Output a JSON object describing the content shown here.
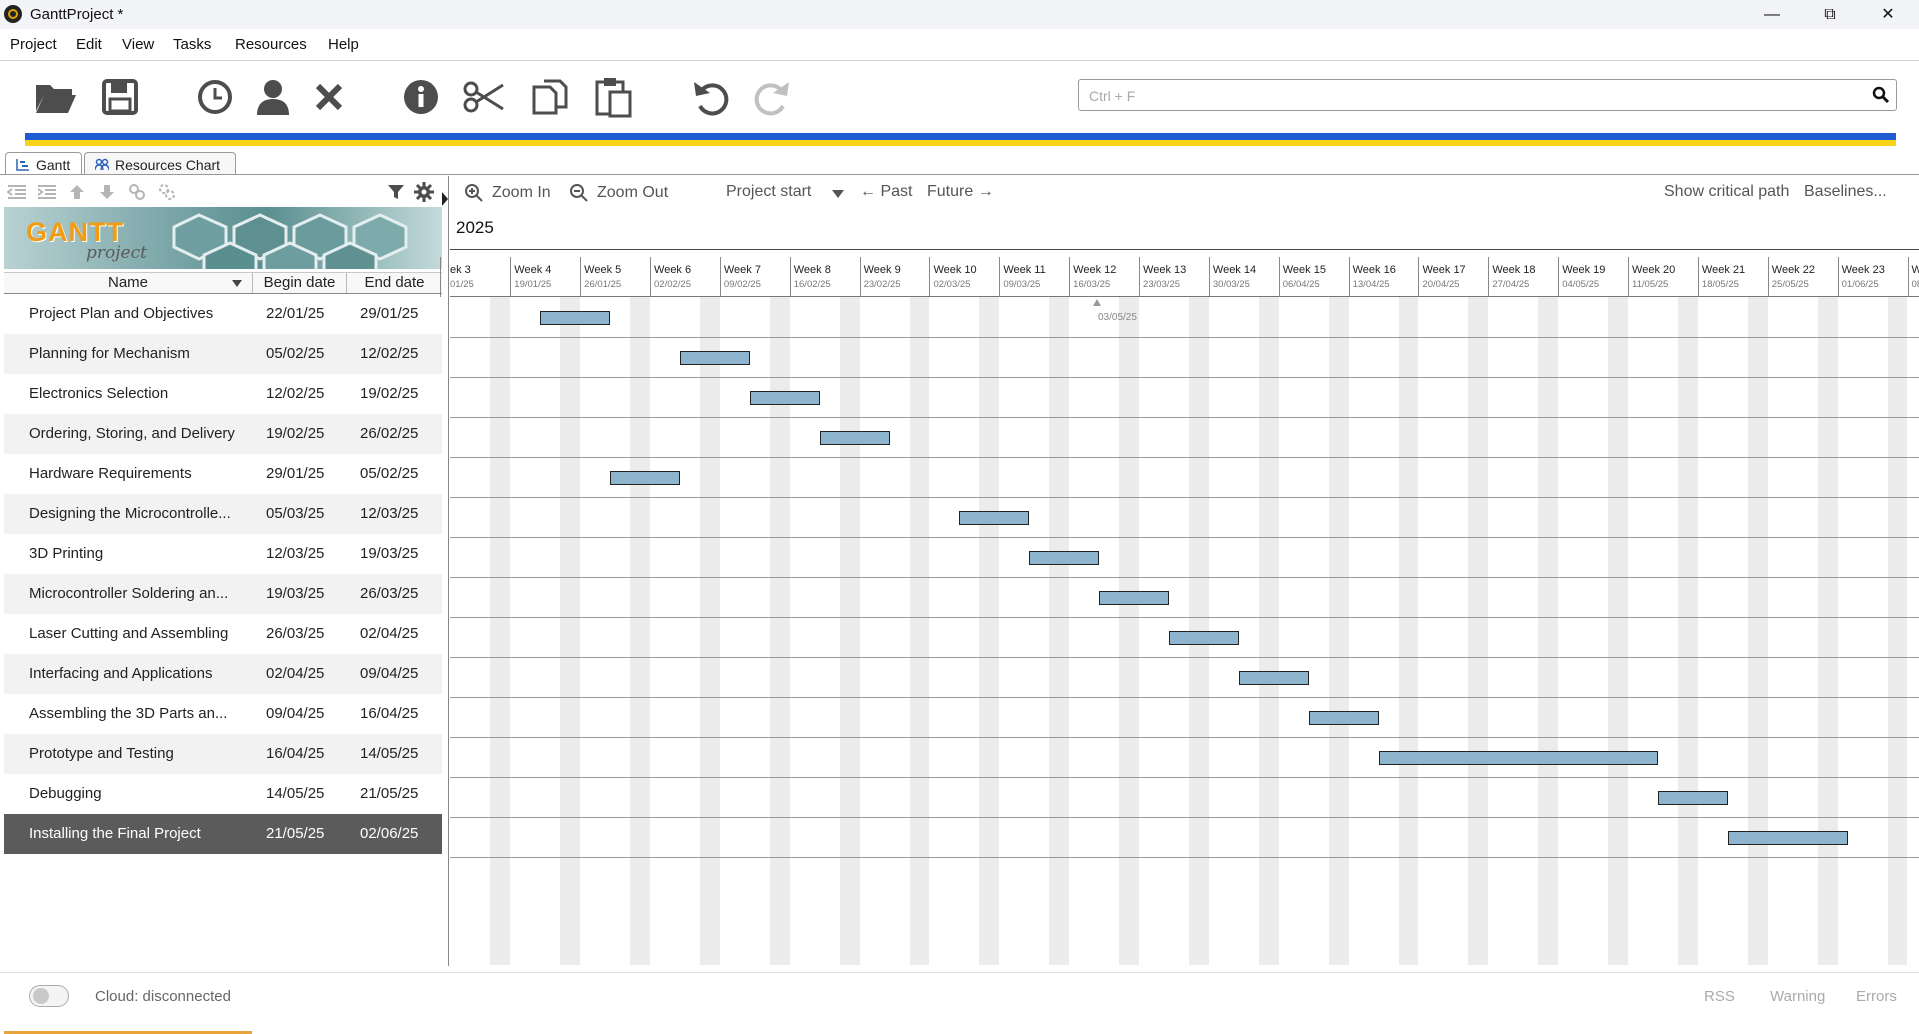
{
  "window": {
    "title": "GanttProject *",
    "minimize": "—",
    "maximize": "⧉",
    "close": "✕"
  },
  "menu": [
    "Project",
    "Edit",
    "View",
    "Tasks",
    "Resources",
    "Help"
  ],
  "toolbar": {
    "icons": [
      "open-folder-icon",
      "save-icon",
      "clock-icon",
      "user-icon",
      "delete-icon",
      "info-icon",
      "cut-icon",
      "copy-icon",
      "paste-icon",
      "undo-icon",
      "redo-icon"
    ],
    "search_placeholder": "Ctrl + F"
  },
  "tabs": [
    {
      "label": "Gantt",
      "active": true
    },
    {
      "label": "Resources Chart",
      "active": false
    }
  ],
  "logo": {
    "main": "GANTT",
    "sub": "project"
  },
  "columns": {
    "name": "Name",
    "begin": "Begin date",
    "end": "End date"
  },
  "tasks": [
    {
      "name": "Project Plan and Objectives",
      "begin": "22/01/25",
      "end": "29/01/25"
    },
    {
      "name": "Planning for Mechanism",
      "begin": "05/02/25",
      "end": "12/02/25"
    },
    {
      "name": "Electronics Selection",
      "begin": "12/02/25",
      "end": "19/02/25"
    },
    {
      "name": "Ordering, Storing, and Delivery",
      "begin": "19/02/25",
      "end": "26/02/25"
    },
    {
      "name": "Hardware Requirements",
      "begin": "29/01/25",
      "end": "05/02/25"
    },
    {
      "name": "Designing the Microcontrolle...",
      "begin": "05/03/25",
      "end": "12/03/25"
    },
    {
      "name": "3D Printing",
      "begin": "12/03/25",
      "end": "19/03/25"
    },
    {
      "name": "Microcontroller Soldering an...",
      "begin": "19/03/25",
      "end": "26/03/25"
    },
    {
      "name": "Laser Cutting and Assembling",
      "begin": "26/03/25",
      "end": "02/04/25"
    },
    {
      "name": "Interfacing and Applications",
      "begin": "02/04/25",
      "end": "09/04/25"
    },
    {
      "name": "Assembling the 3D Parts an...",
      "begin": "09/04/25",
      "end": "16/04/25"
    },
    {
      "name": "Prototype and Testing",
      "begin": "16/04/25",
      "end": "14/05/25"
    },
    {
      "name": "Debugging",
      "begin": "14/05/25",
      "end": "21/05/25"
    },
    {
      "name": "Installing the Final Project",
      "begin": "21/05/25",
      "end": "02/06/25",
      "selected": true
    }
  ],
  "chart_toolbar": {
    "zoom_in": "Zoom In",
    "zoom_out": "Zoom Out",
    "project_start": "Project start",
    "past": "← Past",
    "future": "Future →",
    "critical_path": "Show critical path",
    "baselines": "Baselines..."
  },
  "timeline": {
    "year": "2025",
    "weeks": [
      {
        "label": "ek 3",
        "date": "01/25"
      },
      {
        "label": "Week 4",
        "date": "19/01/25"
      },
      {
        "label": "Week 5",
        "date": "26/01/25"
      },
      {
        "label": "Week 6",
        "date": "02/02/25"
      },
      {
        "label": "Week 7",
        "date": "09/02/25"
      },
      {
        "label": "Week 8",
        "date": "16/02/25"
      },
      {
        "label": "Week 9",
        "date": "23/02/25"
      },
      {
        "label": "Week 10",
        "date": "02/03/25"
      },
      {
        "label": "Week 11",
        "date": "09/03/25"
      },
      {
        "label": "Week 12",
        "date": "16/03/25"
      },
      {
        "label": "Week 13",
        "date": "23/03/25"
      },
      {
        "label": "Week 14",
        "date": "30/03/25"
      },
      {
        "label": "Week 15",
        "date": "06/04/25"
      },
      {
        "label": "Week 16",
        "date": "13/04/25"
      },
      {
        "label": "Week 17",
        "date": "20/04/25"
      },
      {
        "label": "Week 18",
        "date": "27/04/25"
      },
      {
        "label": "Week 19",
        "date": "04/05/25"
      },
      {
        "label": "Week 20",
        "date": "11/05/25"
      },
      {
        "label": "Week 21",
        "date": "18/05/25"
      },
      {
        "label": "Week 22",
        "date": "25/05/25"
      },
      {
        "label": "Week 23",
        "date": "01/06/25"
      },
      {
        "label": "W",
        "date": "08"
      }
    ],
    "today_label": "03/05/25"
  },
  "status": {
    "cloud": "Cloud: disconnected",
    "rss": "RSS",
    "warning": "Warning",
    "errors": "Errors"
  },
  "colors": {
    "bar_fill": "#8fb4cd",
    "selected_row": "#5b5b5b",
    "flag_blue": "#1f5bd1",
    "flag_yellow": "#f7d418"
  }
}
